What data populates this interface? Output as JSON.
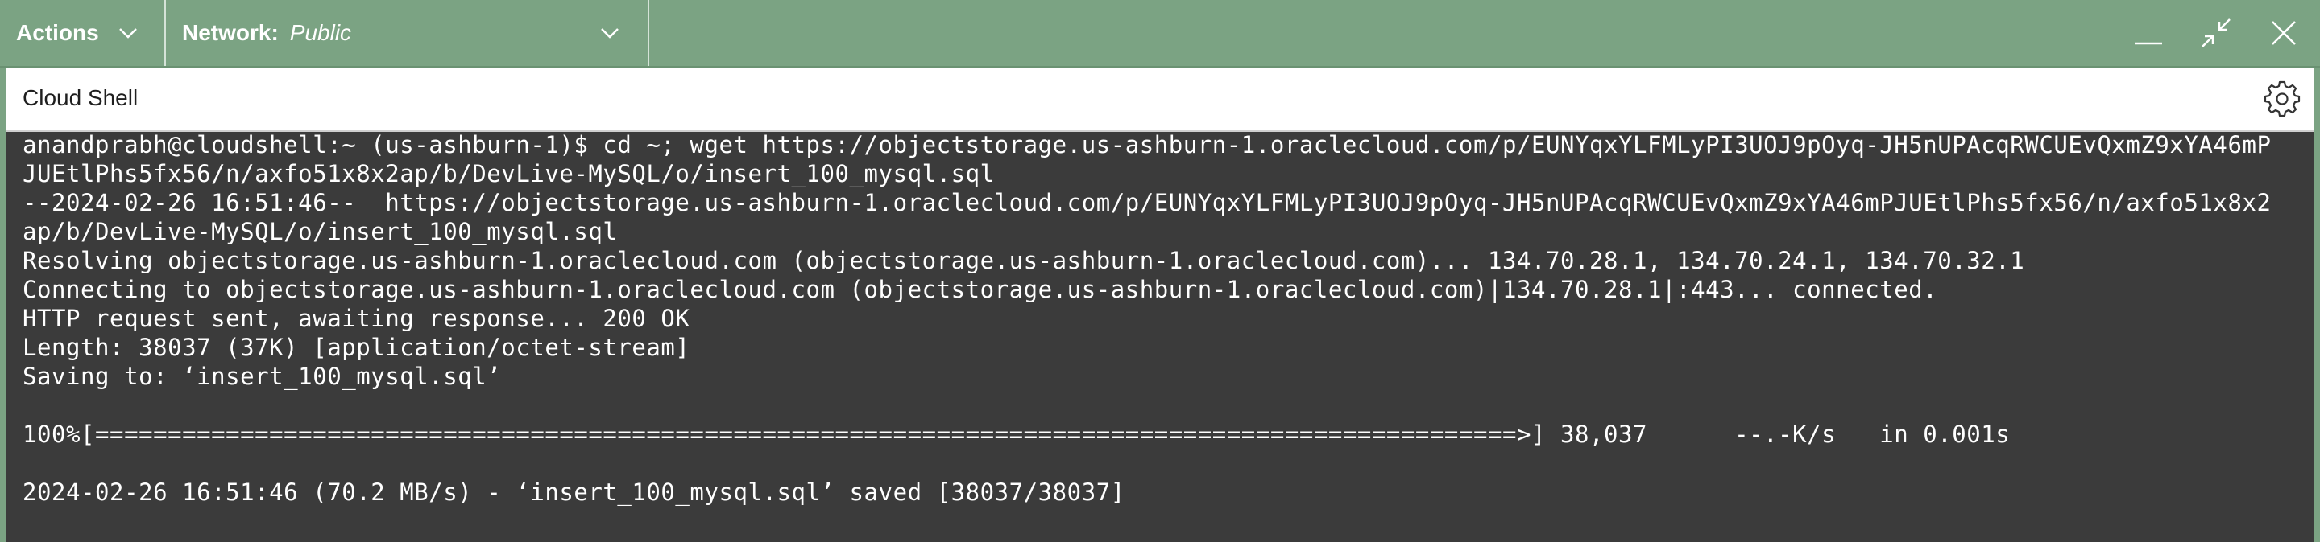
{
  "toolbar": {
    "actions_label": "Actions",
    "network_label": "Network:",
    "network_value": "Public"
  },
  "panel": {
    "title": "Cloud Shell"
  },
  "terminal": {
    "lines": [
      "anandprabh@cloudshell:~ (us-ashburn-1)$ cd ~; wget https://objectstorage.us-ashburn-1.oraclecloud.com/p/EUNYqxYLFMLyPI3UOJ9pOyq-JH5nUPAcqRWCUEvQxmZ9xYA46mP",
      "JUEtlPhs5fx56/n/axfo51x8x2ap/b/DevLive-MySQL/o/insert_100_mysql.sql",
      "--2024-02-26 16:51:46--  https://objectstorage.us-ashburn-1.oraclecloud.com/p/EUNYqxYLFMLyPI3UOJ9pOyq-JH5nUPAcqRWCUEvQxmZ9xYA46mPJUEtlPhs5fx56/n/axfo51x8x2",
      "ap/b/DevLive-MySQL/o/insert_100_mysql.sql",
      "Resolving objectstorage.us-ashburn-1.oraclecloud.com (objectstorage.us-ashburn-1.oraclecloud.com)... 134.70.28.1, 134.70.24.1, 134.70.32.1",
      "Connecting to objectstorage.us-ashburn-1.oraclecloud.com (objectstorage.us-ashburn-1.oraclecloud.com)|134.70.28.1|:443... connected.",
      "HTTP request sent, awaiting response... 200 OK",
      "Length: 38037 (37K) [application/octet-stream]",
      "Saving to: ‘insert_100_mysql.sql’",
      "",
      "100%[==================================================================================================>] 38,037      --.-K/s   in 0.001s",
      "",
      "2024-02-26 16:51:46 (70.2 MB/s) - ‘insert_100_mysql.sql’ saved [38037/38037]"
    ]
  }
}
